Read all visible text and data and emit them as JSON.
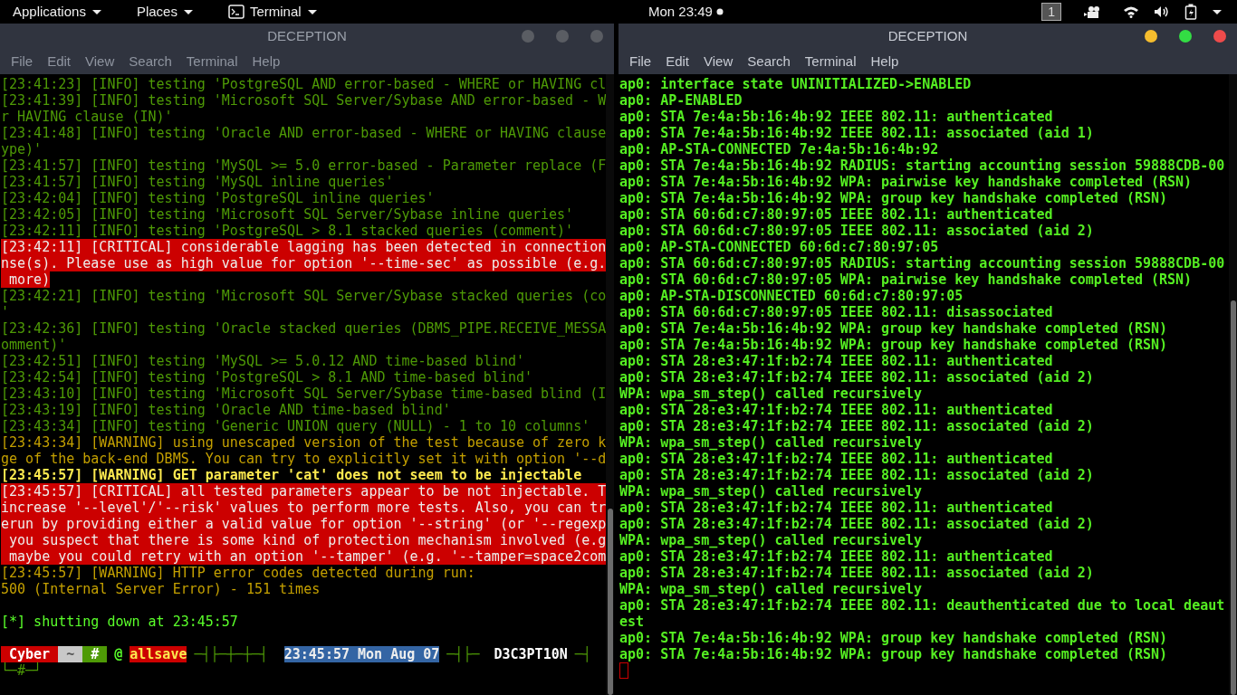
{
  "top_bar": {
    "menus": [
      {
        "label": "Applications",
        "icon": false
      },
      {
        "label": "Places",
        "icon": false
      },
      {
        "label": "Terminal",
        "icon": true
      }
    ],
    "clock": "Mon 23:49",
    "workspace": "1"
  },
  "windows": [
    {
      "title": "DECEPTION",
      "focused": false,
      "menu": [
        "File",
        "Edit",
        "View",
        "Search",
        "Terminal",
        "Help"
      ],
      "lines": [
        {
          "kind": "info",
          "text": "[23:41:23] [INFO] testing 'PostgreSQL AND error-based - WHERE or HAVING cl"
        },
        {
          "kind": "info",
          "text": "[23:41:39] [INFO] testing 'Microsoft SQL Server/Sybase AND error-based - W"
        },
        {
          "kind": "info",
          "text": "r HAVING clause (IN)'"
        },
        {
          "kind": "info",
          "text": "[23:41:48] [INFO] testing 'Oracle AND error-based - WHERE or HAVING clause"
        },
        {
          "kind": "info",
          "text": "ype)'"
        },
        {
          "kind": "info",
          "text": "[23:41:57] [INFO] testing 'MySQL >= 5.0 error-based - Parameter replace (F"
        },
        {
          "kind": "info",
          "text": "[23:41:57] [INFO] testing 'MySQL inline queries'"
        },
        {
          "kind": "info",
          "text": "[23:42:04] [INFO] testing 'PostgreSQL inline queries'"
        },
        {
          "kind": "info",
          "text": "[23:42:05] [INFO] testing 'Microsoft SQL Server/Sybase inline queries'"
        },
        {
          "kind": "info",
          "text": "[23:42:11] [INFO] testing 'PostgreSQL > 8.1 stacked queries (comment)'"
        },
        {
          "kind": "critical",
          "text": "[23:42:11] [CRITICAL] considerable lagging has been detected in connection"
        },
        {
          "kind": "critical",
          "text": "nse(s). Please use as high value for option '--time-sec' as possible (e.g."
        },
        {
          "kind": "critical",
          "text": " more)"
        },
        {
          "kind": "info",
          "text": "[23:42:21] [INFO] testing 'Microsoft SQL Server/Sybase stacked queries (co"
        },
        {
          "kind": "info",
          "text": "'"
        },
        {
          "kind": "info",
          "text": "[23:42:36] [INFO] testing 'Oracle stacked queries (DBMS_PIPE.RECEIVE_MESSA"
        },
        {
          "kind": "info",
          "text": "omment)'"
        },
        {
          "kind": "info",
          "text": "[23:42:51] [INFO] testing 'MySQL >= 5.0.12 AND time-based blind'"
        },
        {
          "kind": "info",
          "text": "[23:42:54] [INFO] testing 'PostgreSQL > 8.1 AND time-based blind'"
        },
        {
          "kind": "info",
          "text": "[23:43:10] [INFO] testing 'Microsoft SQL Server/Sybase time-based blind (I"
        },
        {
          "kind": "info",
          "text": "[23:43:19] [INFO] testing 'Oracle AND time-based blind'"
        },
        {
          "kind": "info",
          "text": "[23:43:34] [INFO] testing 'Generic UNION query (NULL) - 1 to 10 columns'"
        },
        {
          "kind": "warning",
          "text": "[23:43:34] [WARNING] using unescaped version of the test because of zero k"
        },
        {
          "kind": "warning",
          "text": "ge of the back-end DBMS. You can try to explicitly set it with option '--d"
        },
        {
          "kind": "alert",
          "text": "[23:45:57] [WARNING] GET parameter 'cat' does not seem to be injectable"
        },
        {
          "kind": "critical",
          "text": "[23:45:57] [CRITICAL] all tested parameters appear to be not injectable. T"
        },
        {
          "kind": "critical",
          "text": "increase '--level'/'--risk' values to perform more tests. Also, you can tr"
        },
        {
          "kind": "critical",
          "text": "erun by providing either a valid value for option '--string' (or '--regexp"
        },
        {
          "kind": "critical",
          "text": " you suspect that there is some kind of protection mechanism involved (e.g"
        },
        {
          "kind": "critical",
          "text": " maybe you could retry with an option '--tamper' (e.g. '--tamper=space2com"
        },
        {
          "kind": "warning",
          "text": "[23:45:57] [WARNING] HTTP error codes detected during run:"
        },
        {
          "kind": "warning",
          "text": "500 (Internal Server Error) - 151 times"
        },
        {
          "kind": "blank"
        },
        {
          "kind": "success",
          "text": "[*] shutting down at 23:45:57"
        },
        {
          "kind": "blank"
        },
        {
          "kind": "prompt",
          "segments": [
            {
              "kind": "user",
              "text": "Cyber"
            },
            {
              "kind": "dir",
              "text": "~"
            },
            {
              "kind": "root",
              "text": "#"
            },
            {
              "kind": "plain",
              "text": "@"
            },
            {
              "kind": "host",
              "text": "allsave"
            },
            {
              "kind": "line",
              "text": "─┤├─┼─┼─┤"
            },
            {
              "kind": "time",
              "text": "23:45:57 Mon Aug 07"
            },
            {
              "kind": "line",
              "text": "─┤├─"
            },
            {
              "kind": "name",
              "text": "D3C3PT10N"
            },
            {
              "kind": "line",
              "text": "─┤"
            }
          ]
        },
        {
          "kind": "prompt",
          "segments": [
            {
              "kind": "line",
              "text": "└─#─┘"
            }
          ]
        }
      ]
    },
    {
      "title": "DECEPTION",
      "focused": true,
      "menu": [
        "File",
        "Edit",
        "View",
        "Search",
        "Terminal",
        "Help"
      ],
      "lines": [
        {
          "kind": "log",
          "text": "ap0: interface state UNINITIALIZED->ENABLED"
        },
        {
          "kind": "log",
          "text": "ap0: AP-ENABLED"
        },
        {
          "kind": "log",
          "text": "ap0: STA 7e:4a:5b:16:4b:92 IEEE 802.11: authenticated"
        },
        {
          "kind": "log",
          "text": "ap0: STA 7e:4a:5b:16:4b:92 IEEE 802.11: associated (aid 1)"
        },
        {
          "kind": "log",
          "text": "ap0: AP-STA-CONNECTED 7e:4a:5b:16:4b:92"
        },
        {
          "kind": "log",
          "text": "ap0: STA 7e:4a:5b:16:4b:92 RADIUS: starting accounting session 59888CDB-00"
        },
        {
          "kind": "log",
          "text": "ap0: STA 7e:4a:5b:16:4b:92 WPA: pairwise key handshake completed (RSN)"
        },
        {
          "kind": "log",
          "text": "ap0: STA 7e:4a:5b:16:4b:92 WPA: group key handshake completed (RSN)"
        },
        {
          "kind": "log",
          "text": "ap0: STA 60:6d:c7:80:97:05 IEEE 802.11: authenticated"
        },
        {
          "kind": "log",
          "text": "ap0: STA 60:6d:c7:80:97:05 IEEE 802.11: associated (aid 2)"
        },
        {
          "kind": "log",
          "text": "ap0: AP-STA-CONNECTED 60:6d:c7:80:97:05"
        },
        {
          "kind": "log",
          "text": "ap0: STA 60:6d:c7:80:97:05 RADIUS: starting accounting session 59888CDB-00"
        },
        {
          "kind": "log",
          "text": "ap0: STA 60:6d:c7:80:97:05 WPA: pairwise key handshake completed (RSN)"
        },
        {
          "kind": "log",
          "text": "ap0: AP-STA-DISCONNECTED 60:6d:c7:80:97:05"
        },
        {
          "kind": "log",
          "text": "ap0: STA 60:6d:c7:80:97:05 IEEE 802.11: disassociated"
        },
        {
          "kind": "log",
          "text": "ap0: STA 7e:4a:5b:16:4b:92 WPA: group key handshake completed (RSN)"
        },
        {
          "kind": "log",
          "text": "ap0: STA 7e:4a:5b:16:4b:92 WPA: group key handshake completed (RSN)"
        },
        {
          "kind": "log",
          "text": "ap0: STA 28:e3:47:1f:b2:74 IEEE 802.11: authenticated"
        },
        {
          "kind": "log",
          "text": "ap0: STA 28:e3:47:1f:b2:74 IEEE 802.11: associated (aid 2)"
        },
        {
          "kind": "log",
          "text": "WPA: wpa_sm_step() called recursively"
        },
        {
          "kind": "log",
          "text": "ap0: STA 28:e3:47:1f:b2:74 IEEE 802.11: authenticated"
        },
        {
          "kind": "log",
          "text": "ap0: STA 28:e3:47:1f:b2:74 IEEE 802.11: associated (aid 2)"
        },
        {
          "kind": "log",
          "text": "WPA: wpa_sm_step() called recursively"
        },
        {
          "kind": "log",
          "text": "ap0: STA 28:e3:47:1f:b2:74 IEEE 802.11: authenticated"
        },
        {
          "kind": "log",
          "text": "ap0: STA 28:e3:47:1f:b2:74 IEEE 802.11: associated (aid 2)"
        },
        {
          "kind": "log",
          "text": "WPA: wpa_sm_step() called recursively"
        },
        {
          "kind": "log",
          "text": "ap0: STA 28:e3:47:1f:b2:74 IEEE 802.11: authenticated"
        },
        {
          "kind": "log",
          "text": "ap0: STA 28:e3:47:1f:b2:74 IEEE 802.11: associated (aid 2)"
        },
        {
          "kind": "log",
          "text": "WPA: wpa_sm_step() called recursively"
        },
        {
          "kind": "log",
          "text": "ap0: STA 28:e3:47:1f:b2:74 IEEE 802.11: authenticated"
        },
        {
          "kind": "log",
          "text": "ap0: STA 28:e3:47:1f:b2:74 IEEE 802.11: associated (aid 2)"
        },
        {
          "kind": "log",
          "text": "WPA: wpa_sm_step() called recursively"
        },
        {
          "kind": "log",
          "text": "ap0: STA 28:e3:47:1f:b2:74 IEEE 802.11: deauthenticated due to local deaut"
        },
        {
          "kind": "log",
          "text": "est"
        },
        {
          "kind": "log",
          "text": "ap0: STA 7e:4a:5b:16:4b:92 WPA: group key handshake completed (RSN)"
        },
        {
          "kind": "log",
          "text": "ap0: STA 7e:4a:5b:16:4b:92 WPA: group key handshake completed (RSN)"
        },
        {
          "kind": "cursor"
        }
      ]
    }
  ]
}
